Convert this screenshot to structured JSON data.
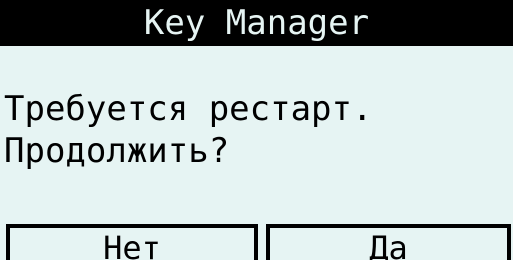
{
  "dialog": {
    "title": "Key Manager",
    "message_line1": "Требуется рестарт.",
    "message_line2": "Продолжить?",
    "buttons": {
      "no_label": "Нет",
      "yes_label": "Да"
    }
  },
  "colors": {
    "background": "#e6f4f3",
    "foreground": "#000000"
  }
}
